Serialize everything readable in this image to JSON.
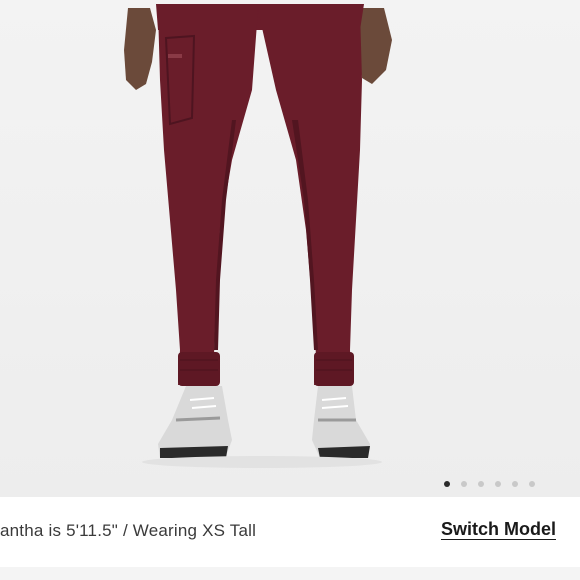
{
  "product": {
    "image_alt": "Burgundy jogger scrub pants worn with grey sneakers",
    "pant_color": "#6a1d2a",
    "sneaker_color": "#d9d9d9"
  },
  "carousel": {
    "total_slides": 6,
    "active_index": 0
  },
  "model_info": {
    "caption": "antha is 5'11.5\" / Wearing XS Tall",
    "switch_label": "Switch Model"
  }
}
